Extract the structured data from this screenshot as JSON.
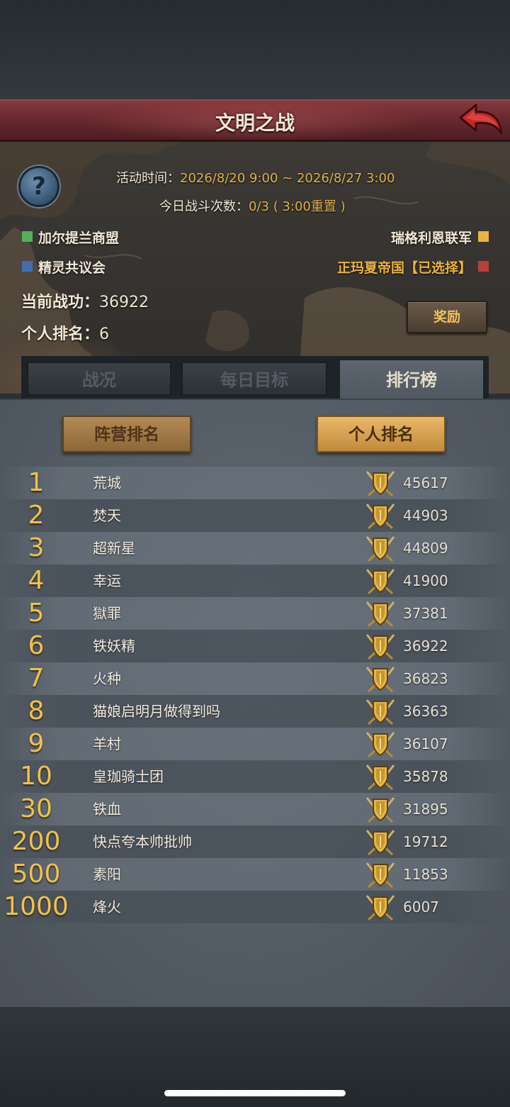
{
  "header": {
    "title": "文明之战",
    "back_icon": "back-arrow-icon"
  },
  "event": {
    "time_label": "活动时间：",
    "time_value": "2026/8/20 9:00 ~ 2026/8/27 3:00",
    "battles_label": "今日战斗次数：",
    "battles_value": "0/3 ( 3:00重置 )"
  },
  "factions": [
    {
      "name": "加尔提兰商盟",
      "color": "#4fb25a"
    },
    {
      "name": "精灵共议会",
      "color": "#3f6fb0"
    },
    {
      "name": "瑞格利恩联军",
      "color": "#e9b344"
    },
    {
      "name": "正玛夏帝国【已选择】",
      "color": "#b8403a"
    }
  ],
  "stats": {
    "merit_label": "当前战功：",
    "merit_value": "36922",
    "rank_label": "个人排名：",
    "rank_value": "6"
  },
  "reward_button": "奖励",
  "tabs": [
    "战况",
    "每日目标",
    "排行榜"
  ],
  "active_tab": "排行榜",
  "toggles": {
    "camp": "阵营排名",
    "personal": "个人排名",
    "selected": "个人排名"
  },
  "ranking": [
    {
      "rank": "1",
      "name": "荒城",
      "score": "45617"
    },
    {
      "rank": "2",
      "name": "焚天",
      "score": "44903"
    },
    {
      "rank": "3",
      "name": "超新星",
      "score": "44809"
    },
    {
      "rank": "4",
      "name": "幸运",
      "score": "41900"
    },
    {
      "rank": "5",
      "name": "獄罪",
      "score": "37381"
    },
    {
      "rank": "6",
      "name": "铁妖精",
      "score": "36922"
    },
    {
      "rank": "7",
      "name": "火种",
      "score": "36823"
    },
    {
      "rank": "8",
      "name": "猫娘启明月做得到吗",
      "score": "36363"
    },
    {
      "rank": "9",
      "name": "羊村",
      "score": "36107"
    },
    {
      "rank": "10",
      "name": "皇珈骑士团",
      "score": "35878"
    },
    {
      "rank": "30",
      "name": "铁血",
      "score": "31895"
    },
    {
      "rank": "200",
      "name": "快点夸本帅批帅",
      "score": "19712"
    },
    {
      "rank": "500",
      "name": "素阳",
      "score": "11853"
    },
    {
      "rank": "1000",
      "name": "烽火",
      "score": "6007"
    }
  ],
  "icons": {
    "help": "help-question-icon",
    "rank_badge": "shield-swords-badge-icon"
  }
}
